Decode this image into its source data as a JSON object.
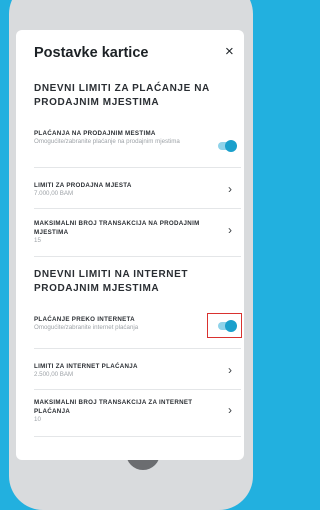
{
  "header": {
    "title": "Postavke kartice",
    "close_glyph": "×"
  },
  "sections": [
    {
      "title": "DNEVNI LIMITI ZA PLAĆANJE NA PRODAJNIM MJESTIMA",
      "items": [
        {
          "title": "PLAĆANJA NA PRODAJNIM MESTIMA",
          "subtitle": "Omogućite/zabranite plaćanje na prodajnim mjestima",
          "control": "toggle",
          "toggle_on": true
        },
        {
          "title": "LIMITI ZA PRODAJNA MJESTA",
          "subtitle": "7.000,00 BAM",
          "control": "chevron"
        },
        {
          "title": "MAKSIMALNI BROJ TRANSAKCIJA NA PRODAJNIM MJESTIMA",
          "subtitle": "15",
          "control": "chevron"
        }
      ]
    },
    {
      "title": "DNEVNI LIMITI NA INTERNET PRODAJNIM MJESTIMA",
      "items": [
        {
          "title": "PLAĆANJE PREKO INTERNETA",
          "subtitle": "Omogućite/zabranite internet plaćanja",
          "control": "toggle",
          "toggle_on": true,
          "highlighted": true
        },
        {
          "title": "LIMITI ZA INTERNET PLAĆANJA",
          "subtitle": "2.500,00 BAM",
          "control": "chevron"
        },
        {
          "title": "MAKSIMALNI BROJ TRANSAKCIJA ZA INTERNET PLAĆANJA",
          "subtitle": "10",
          "control": "chevron"
        }
      ]
    }
  ],
  "chevron_glyph": "›",
  "colors": {
    "background": "#22b0df",
    "toggle_on": "#1aa0cc",
    "highlight": "#d9322f",
    "panel": "#ffffff"
  }
}
